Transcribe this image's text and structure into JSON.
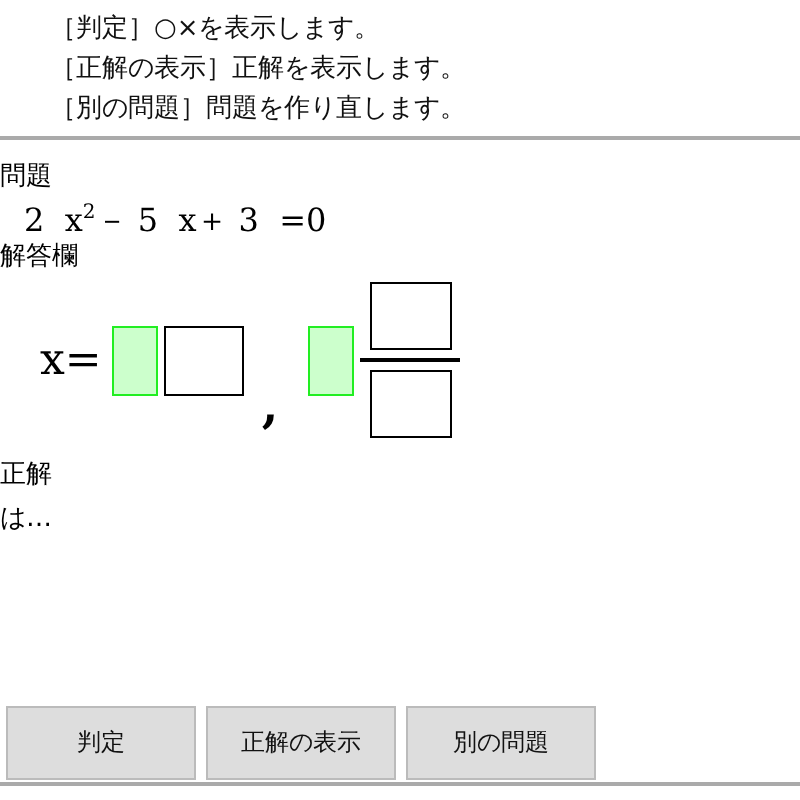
{
  "instructions": [
    "［判定］○×を表示します。",
    "［正解の表示］正解を表示します。",
    "［別の問題］問題を作り直します。"
  ],
  "problem": {
    "label": "問題",
    "equation": "2  x$^{2}$－ 5  x＋ 3  =0"
  },
  "answer": {
    "label": "解答欄",
    "items": [
      {
        "kind": "text",
        "text": "x="
      },
      {
        "kind": "box",
        "highlighted": true
      },
      {
        "kind": "box",
        "highlighted": false
      },
      {
        "kind": "comma",
        "text": ","
      },
      {
        "kind": "box",
        "highlighted": true
      },
      {
        "kind": "fraction"
      }
    ]
  },
  "result": {
    "lines": [
      "正解",
      "は…"
    ]
  },
  "buttons": [
    "判定",
    "正解の表示",
    "別の問題"
  ]
}
